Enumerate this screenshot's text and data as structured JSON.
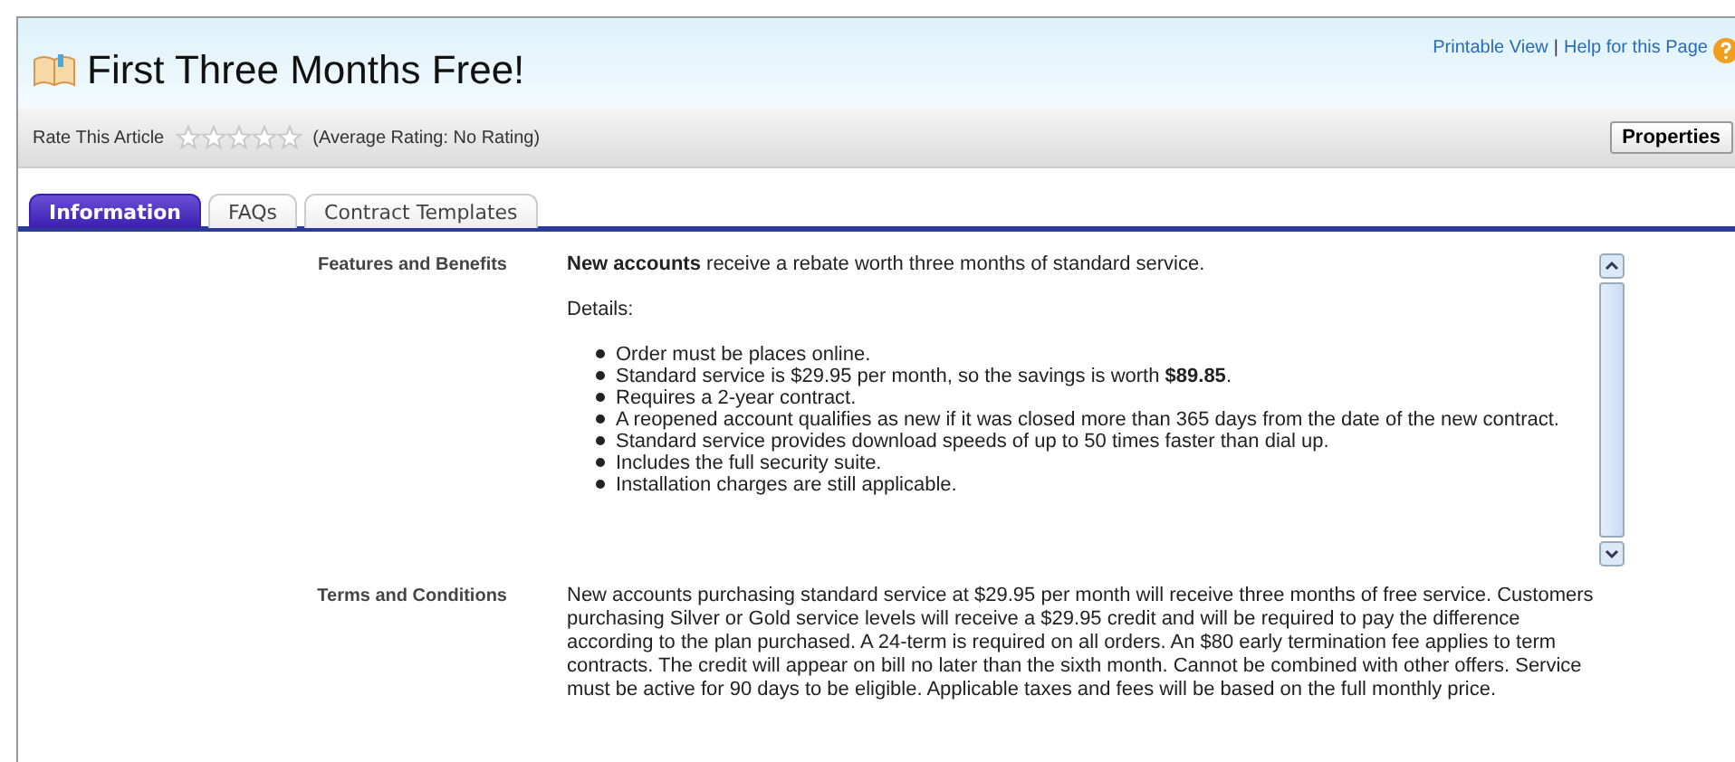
{
  "header": {
    "title": "First Three Months Free!",
    "links": [
      "Printable View",
      "Help for this Page"
    ],
    "separator": "|"
  },
  "rating": {
    "label": "Rate This Article",
    "stars": 0,
    "average": "(Average Rating: No Rating)",
    "button": "Properties"
  },
  "tabs": [
    {
      "label": "Information",
      "selected": true
    },
    {
      "label": "FAQs",
      "selected": false
    },
    {
      "label": "Contract Templates",
      "selected": false
    }
  ],
  "fields": [
    {
      "label": "Features and Benefits",
      "kind": "list",
      "intro": "**New accounts** receive a rebate worth three months of standard service.",
      "subhead": "Details:",
      "items": [
        "Order must be places online.",
        "Standard service is $29.95 per month, so the savings is worth **$89.85**.",
        "Requires a 2-year contract.",
        "A reopened account qualifies as new if it was closed more than 365 days from the date of the new contract.",
        "Standard service provides download speeds of up to 50 times faster than dial up.",
        "Includes the full security suite.",
        "Installation charges are still applicable."
      ]
    },
    {
      "label": "Terms and Conditions",
      "kind": "text",
      "text": "New accounts purchasing standard service at $29.95 per month will receive three months of free service. Customers purchasing Silver or Gold service levels will receive a $29.95 credit and will be required to pay the difference according to the plan purchased. A 24-term is required on all orders. An $80 early termination fee applies to term contracts. The credit will appear on bill no later than the sixth month. Cannot be combined with other offers. Service must be active for 90 days to be eligible. Applicable taxes and fees will be based on the full monthly price."
    }
  ]
}
